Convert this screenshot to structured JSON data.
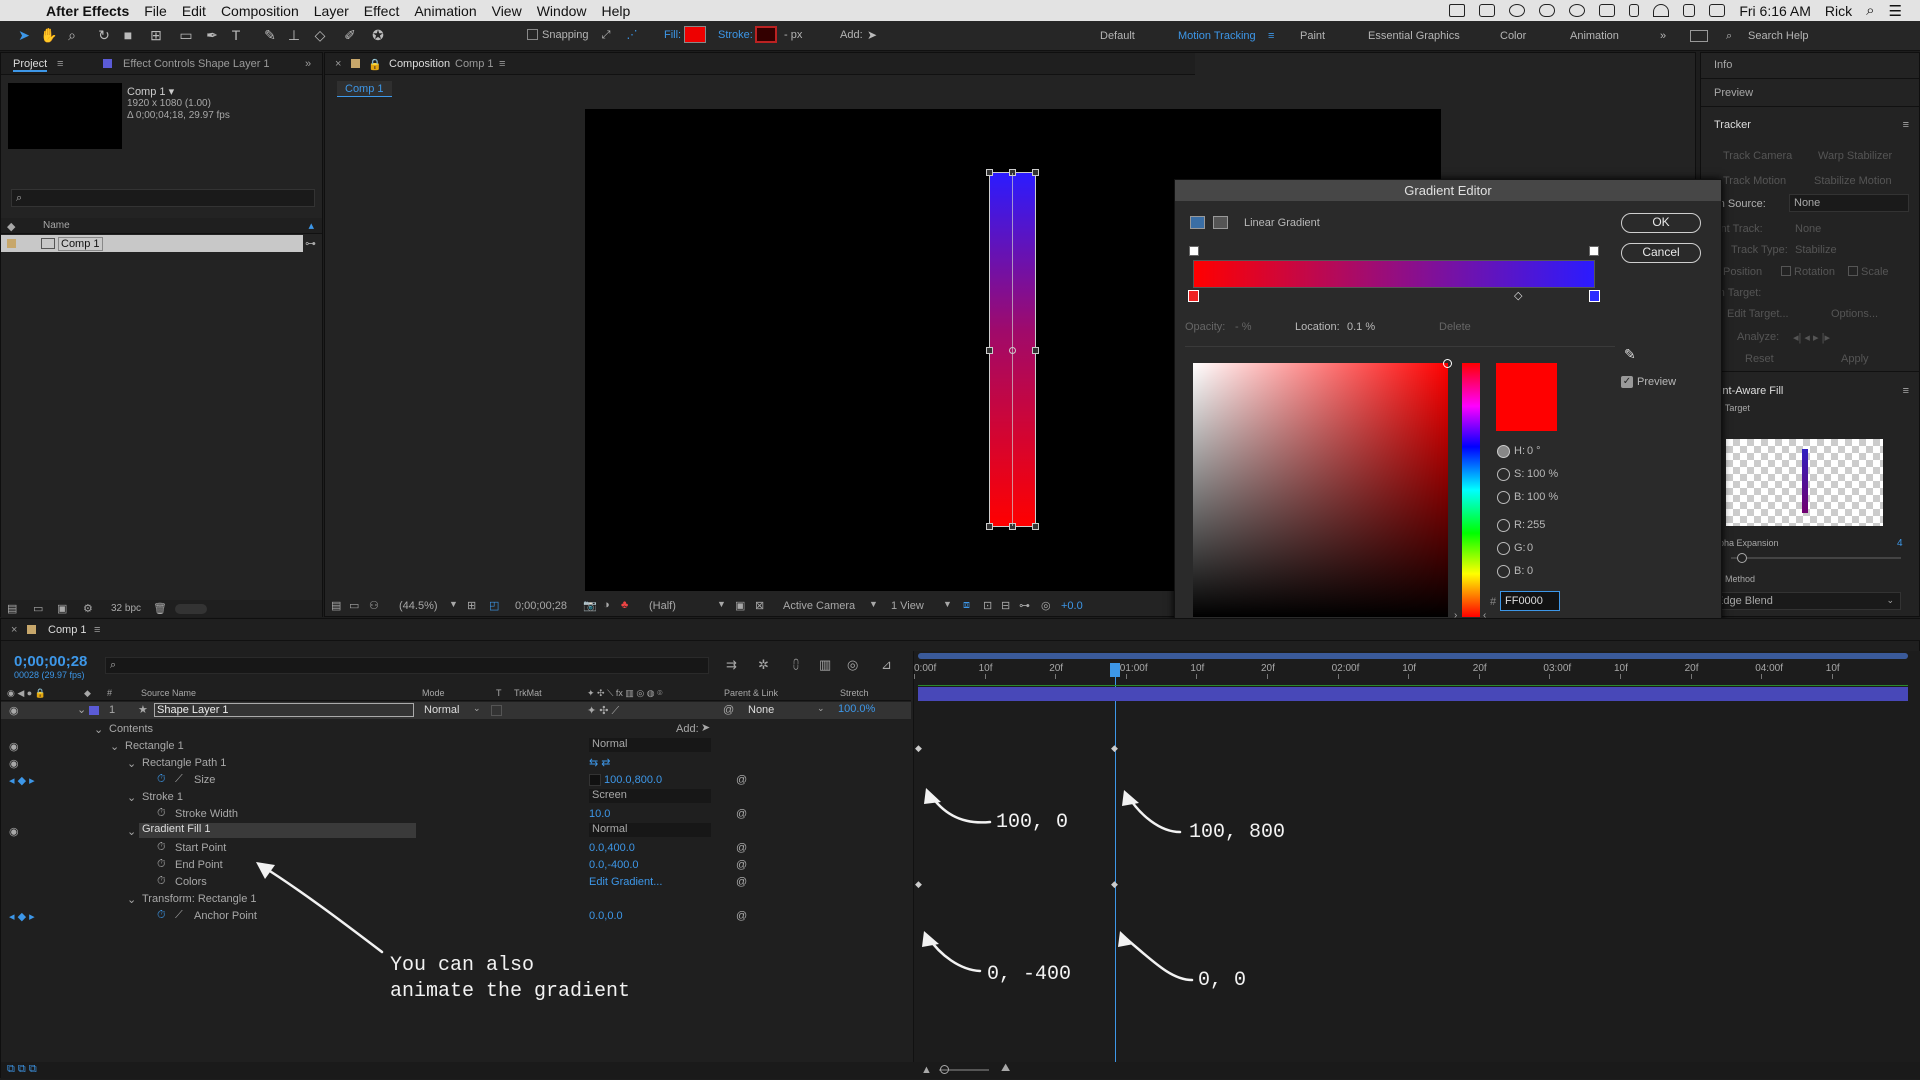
{
  "menubar": {
    "app": "After Effects",
    "items": [
      "File",
      "Edit",
      "Composition",
      "Layer",
      "Effect",
      "Animation",
      "View",
      "Window",
      "Help"
    ],
    "clock": "Fri 6:16 AM",
    "user": "Rick"
  },
  "toolbar": {
    "snapping": "Snapping",
    "fill": "Fill:",
    "stroke": "Stroke:",
    "px": "- px",
    "add": "Add:",
    "workspaces": [
      "Default",
      "Motion Tracking",
      "Paint",
      "Essential Graphics",
      "Color",
      "Animation"
    ],
    "search_placeholder": "Search Help"
  },
  "project": {
    "tab_project": "Project",
    "tab_effect": "Effect Controls Shape Layer 1",
    "comp_name": "Comp 1 ▾",
    "comp_size": "1920 x 1080 (1.00)",
    "comp_duration": "Δ 0;00;04;18, 29.97 fps",
    "col_name": "Name",
    "item": "Comp 1",
    "bpc": "32 bpc"
  },
  "composition": {
    "tab": "Composition",
    "tab_comp": "Comp 1",
    "subtab": "Comp 1",
    "zoom": "(44.5%)",
    "timecode": "0;00;00;28",
    "resolution": "(Half)",
    "camera": "Active Camera",
    "views": "1 View",
    "exposure": "+0.0"
  },
  "gradient_editor": {
    "title": "Gradient Editor",
    "type": "Linear Gradient",
    "ok": "OK",
    "cancel": "Cancel",
    "opacity_label": "Opacity:",
    "opacity_value": "- %",
    "location_label": "Location:",
    "location_value": "0.1 %",
    "delete": "Delete",
    "preview": "Preview",
    "h_label": "H:",
    "h_value": "0 °",
    "s_label": "S:",
    "s_value": "100 %",
    "b_label": "B:",
    "b_value": "100 %",
    "r_label": "R:",
    "r_value": "255",
    "g_label": "G:",
    "g_value": "0",
    "bb_label": "B:",
    "bb_value": "0",
    "hex": "FF0000",
    "colors": {
      "start": "#ff0000",
      "end": "#2b1bff"
    }
  },
  "right_panel": {
    "info": "Info",
    "preview": "Preview",
    "tracker": "Tracker",
    "track_camera": "Track Camera",
    "warp_stabilizer": "Warp Stabilizer",
    "track_motion": "Track Motion",
    "stabilize_motion": "Stabilize Motion",
    "motion_source": "otion Source:",
    "motion_source_val": "None",
    "current_track": "urrent Track:",
    "current_track_val": "None",
    "track_type": "Track Type:",
    "track_type_val": "Stabilize",
    "position": "Position",
    "rotation": "Rotation",
    "scale": "Scale",
    "motion_target": "otion Target:",
    "edit_target": "Edit Target...",
    "options": "Options...",
    "analyze": "Analyze:",
    "reset": "Reset",
    "apply": "Apply",
    "caf": "ontent-Aware Fill",
    "fill_target": "Fill Target",
    "alpha_expansion": "Alpha Expansion",
    "alpha_value": "4",
    "fill_method": "Fill Method",
    "fill_method_val": "Edge Blend"
  },
  "timeline": {
    "tab": "Comp 1",
    "timecode": "0;00;00;28",
    "frames": "00028 (29.97 fps)",
    "columns": {
      "source": "Source Name",
      "mode": "Mode",
      "t": "T",
      "trkmat": "TrkMat",
      "parent": "Parent & Link",
      "stretch": "Stretch"
    },
    "layer": {
      "num": "1",
      "name": "Shape Layer 1",
      "mode": "Normal",
      "parent": "None",
      "stretch": "100.0%"
    },
    "contents": "Contents",
    "add": "Add:",
    "props": [
      {
        "name": "Rectangle 1",
        "value": "Normal"
      },
      {
        "name": "Rectangle Path 1",
        "value": ""
      },
      {
        "name": "Size",
        "value": "100.0,800.0"
      },
      {
        "name": "Stroke 1",
        "value": "Screen"
      },
      {
        "name": "Stroke Width",
        "value": "10.0"
      },
      {
        "name": "Gradient Fill 1",
        "value": "Normal"
      },
      {
        "name": "Start Point",
        "value": "0.0,400.0"
      },
      {
        "name": "End Point",
        "value": "0.0,-400.0"
      },
      {
        "name": "Colors",
        "value": "Edit Gradient..."
      },
      {
        "name": "Transform: Rectangle 1",
        "value": ""
      },
      {
        "name": "Anchor Point",
        "value": "0.0,0.0"
      }
    ],
    "ruler": [
      "0:00f",
      "10f",
      "20f",
      "01:00f",
      "10f",
      "20f",
      "02:00f",
      "10f",
      "20f",
      "03:00f",
      "10f",
      "20f",
      "04:00f",
      "10f"
    ]
  },
  "annotations": {
    "a1": "100, 0",
    "a2": "100, 800",
    "a3": "0, -400",
    "a4": "0, 0",
    "note": "You can also\nanimate the gradient"
  }
}
